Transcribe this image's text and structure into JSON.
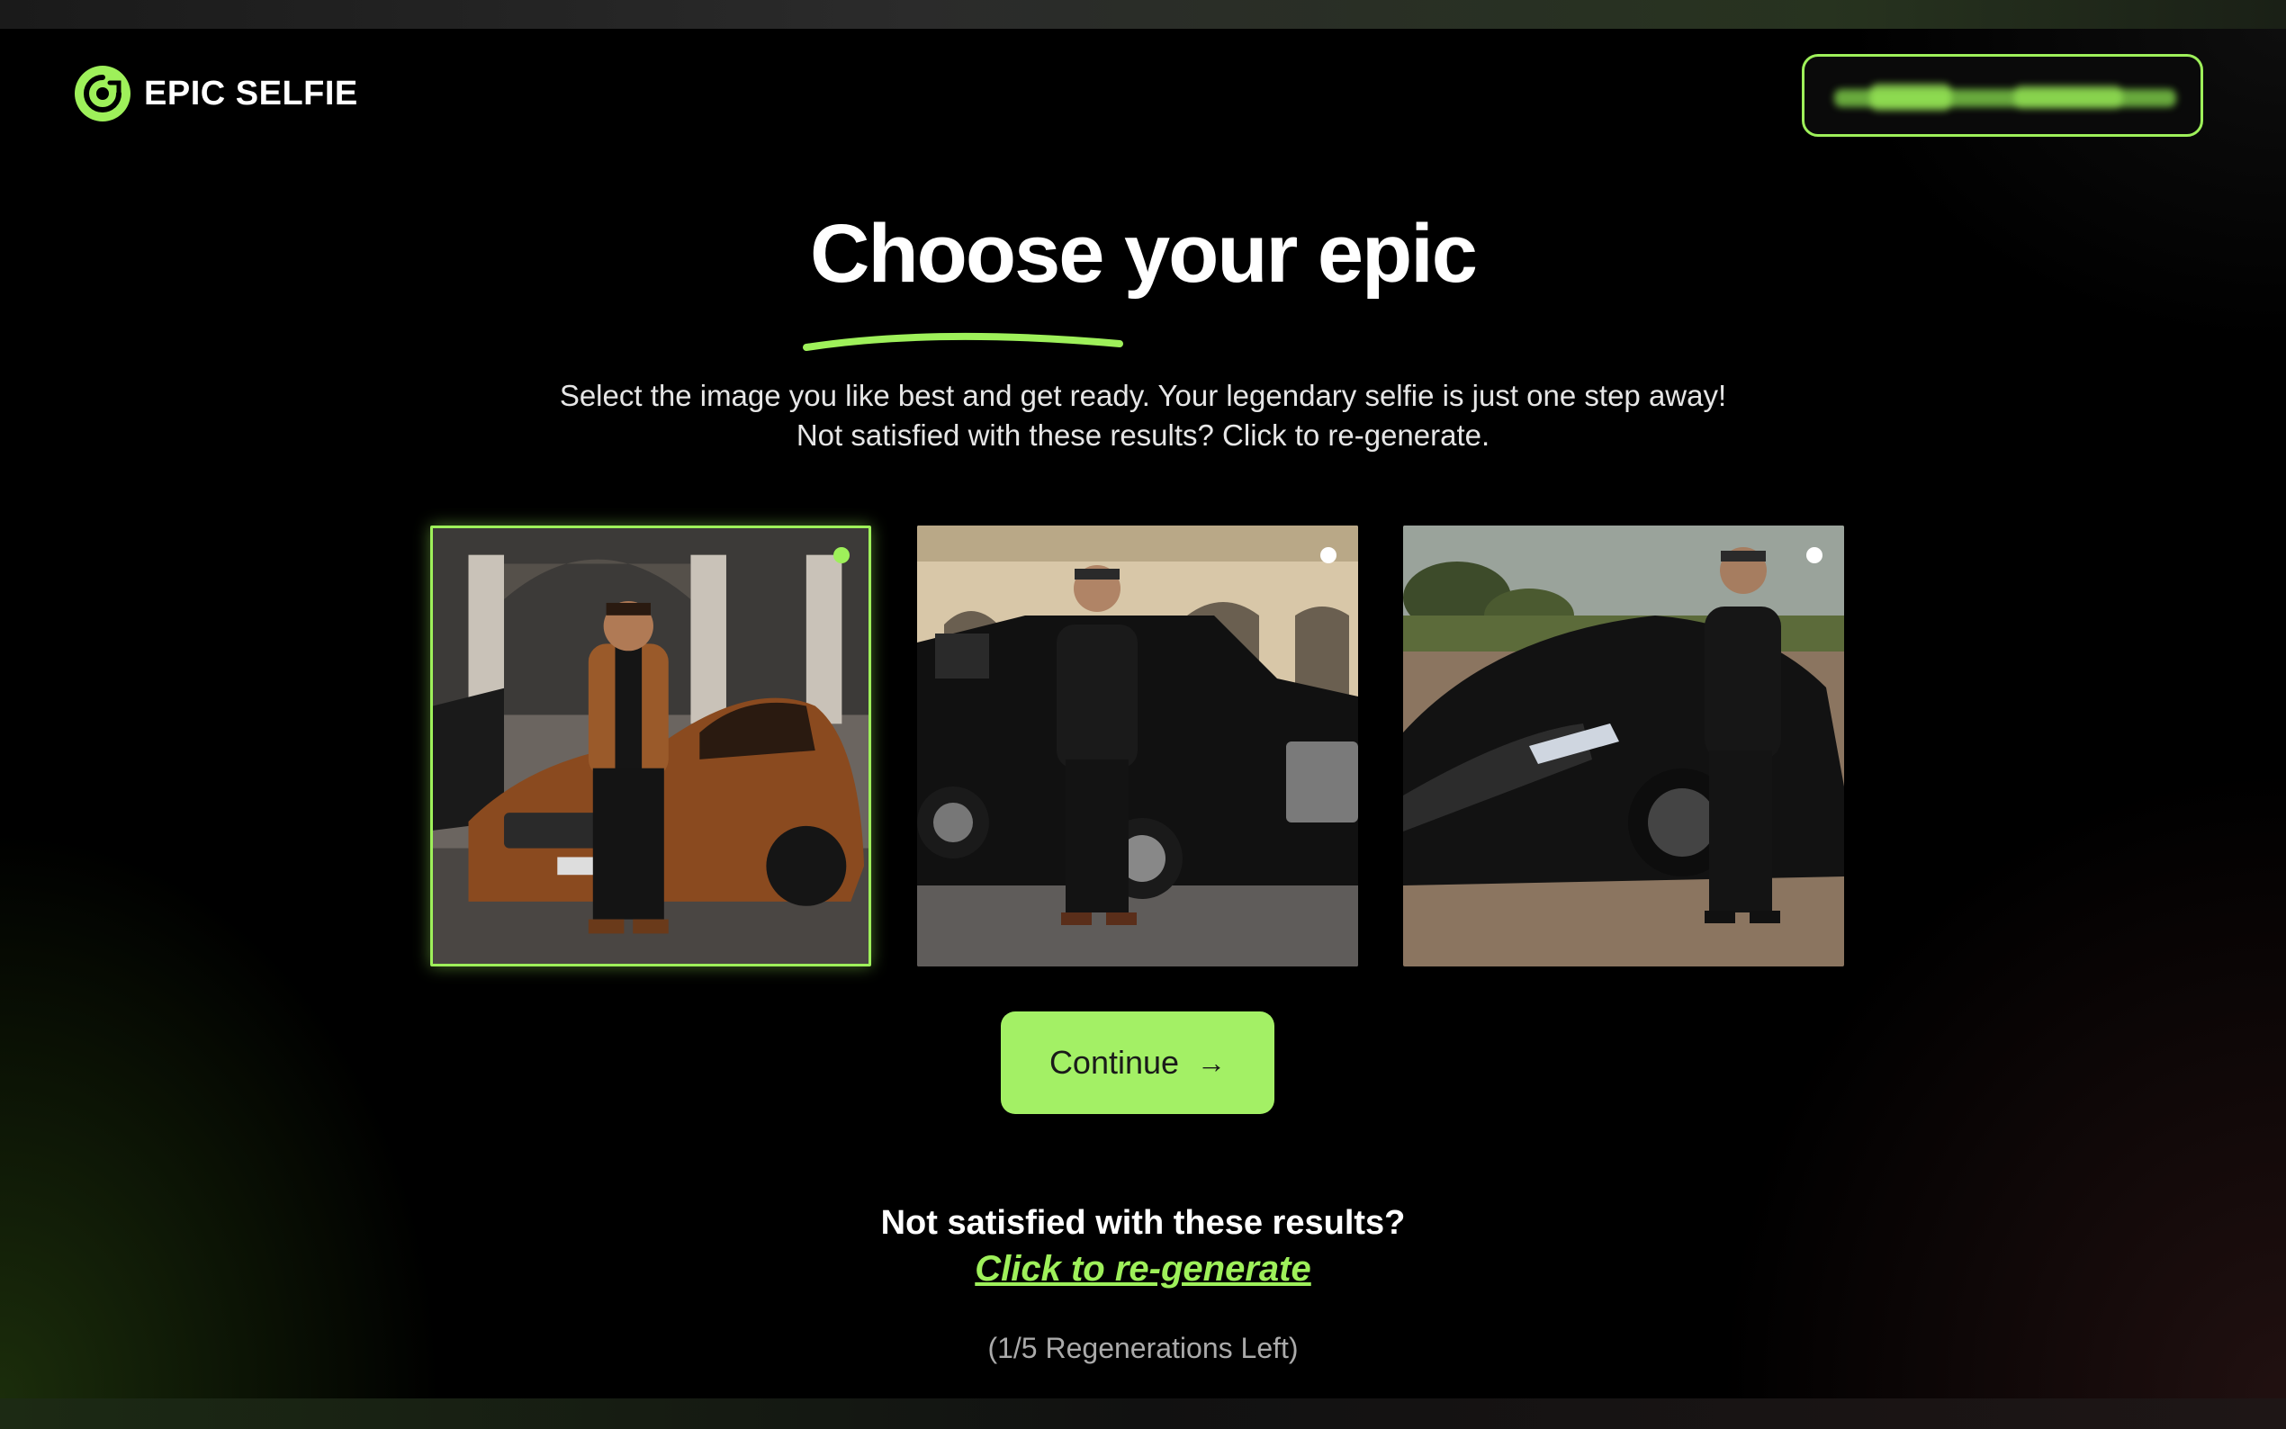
{
  "app": {
    "logo_text": "EPIC SELFIE",
    "account_label": "             "
  },
  "page": {
    "title": "Choose your epic",
    "subtitle_line1": "Select the image you like best and get ready. Your legendary selfie is just one step away!",
    "subtitle_line2": "Not satisfied with these results? Click to re-generate."
  },
  "images": [
    {
      "selected": true,
      "car_color": "#8a4a1f",
      "jacket_color": "#9a5a2a",
      "backdrop": "arches"
    },
    {
      "selected": false,
      "car_color": "#111111",
      "jacket_color": "#1a1a1a",
      "backdrop": "building"
    },
    {
      "selected": false,
      "car_color": "#151515",
      "jacket_color": "#151515",
      "backdrop": "trees"
    }
  ],
  "actions": {
    "continue_label": "Continue",
    "continue_arrow": "→",
    "regen_question": "Not satisfied with these results?",
    "regen_link": "Click to re-generate",
    "regen_count": "(1/5 Regenerations Left)"
  },
  "colors": {
    "accent": "#9ef05a",
    "button": "#a3f065"
  }
}
